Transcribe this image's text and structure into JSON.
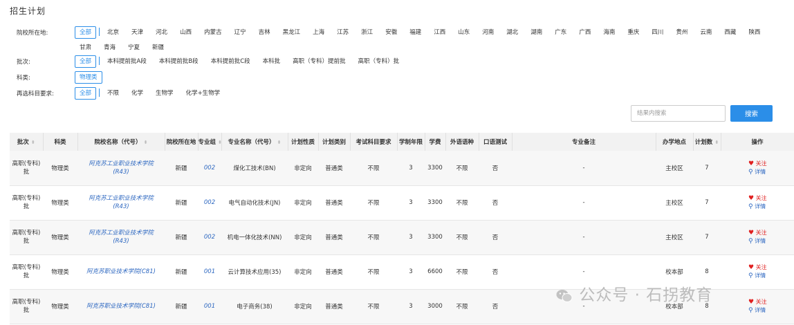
{
  "title": "招生计划",
  "filters": {
    "region": {
      "label": "院校所在地:",
      "options": [
        "全部",
        "北京",
        "天津",
        "河北",
        "山西",
        "内蒙古",
        "辽宁",
        "吉林",
        "黑龙江",
        "上海",
        "江苏",
        "浙江",
        "安徽",
        "福建",
        "江西",
        "山东",
        "河南",
        "湖北",
        "湖南",
        "广东",
        "广西",
        "海南",
        "重庆",
        "四川",
        "贵州",
        "云南",
        "西藏",
        "陕西",
        "甘肃",
        "青海",
        "宁夏",
        "新疆"
      ],
      "selected": "全部"
    },
    "batch": {
      "label": "批次:",
      "options": [
        "全部",
        "本科提前批A段",
        "本科提前批B段",
        "本科提前批C段",
        "本科批",
        "高职（专科）提前批",
        "高职（专科）批"
      ],
      "selected": "全部"
    },
    "category": {
      "label": "科类:",
      "options": [
        "物理类"
      ],
      "selected": "物理类"
    },
    "subjects": {
      "label": "再选科目要求:",
      "options": [
        "全部",
        "不限",
        "化学",
        "生物学",
        "化学+生物学"
      ],
      "selected": "全部"
    }
  },
  "search": {
    "placeholder": "结果内搜索",
    "button": "搜索"
  },
  "table": {
    "headers": [
      "批次",
      "科类",
      "院校名称（代号）",
      "院校所在地",
      "专业组",
      "专业名称（代号）",
      "计划性质",
      "计划类别",
      "考试科目要求",
      "学制年限",
      "学费",
      "外语语种",
      "口语测试",
      "专业备注",
      "办学地点",
      "计划数",
      "操作"
    ],
    "rows": [
      {
        "batch": "高职(专科)批",
        "category": "物理类",
        "school": "阿克苏工业职业技术学院(R43)",
        "location": "新疆",
        "group": "002",
        "major": "煤化工技术(BN)",
        "nature": "非定向",
        "type": "普通类",
        "requirement": "不限",
        "years": "3",
        "fee": "3300",
        "language": "不限",
        "oral": "否",
        "remark": "-",
        "campus": "主校区",
        "plan": "7"
      },
      {
        "batch": "高职(专科)批",
        "category": "物理类",
        "school": "阿克苏工业职业技术学院(R43)",
        "location": "新疆",
        "group": "002",
        "major": "电气自动化技术(JN)",
        "nature": "非定向",
        "type": "普通类",
        "requirement": "不限",
        "years": "3",
        "fee": "3300",
        "language": "不限",
        "oral": "否",
        "remark": "-",
        "campus": "主校区",
        "plan": "7"
      },
      {
        "batch": "高职(专科)批",
        "category": "物理类",
        "school": "阿克苏工业职业技术学院(R43)",
        "location": "新疆",
        "group": "002",
        "major": "机电一体化技术(NN)",
        "nature": "非定向",
        "type": "普通类",
        "requirement": "不限",
        "years": "3",
        "fee": "3300",
        "language": "不限",
        "oral": "否",
        "remark": "-",
        "campus": "主校区",
        "plan": "7"
      },
      {
        "batch": "高职(专科)批",
        "category": "物理类",
        "school": "阿克苏职业技术学院(C81)",
        "location": "新疆",
        "group": "001",
        "major": "云计算技术应用(35)",
        "nature": "非定向",
        "type": "普通类",
        "requirement": "不限",
        "years": "3",
        "fee": "6600",
        "language": "不限",
        "oral": "否",
        "remark": "-",
        "campus": "校本部",
        "plan": "8"
      },
      {
        "batch": "高职(专科)批",
        "category": "物理类",
        "school": "阿克苏职业技术学院(C81)",
        "location": "新疆",
        "group": "001",
        "major": "电子商务(38)",
        "nature": "非定向",
        "type": "普通类",
        "requirement": "不限",
        "years": "3",
        "fee": "3000",
        "language": "不限",
        "oral": "否",
        "remark": "-",
        "campus": "校本部",
        "plan": "8"
      }
    ],
    "actions": {
      "follow": "关注",
      "detail": "详情"
    }
  },
  "watermark": "公众号 · 石拐教育",
  "colors": {
    "accent": "#2b8ee8",
    "link": "#2b66c0",
    "follow": "#e02020",
    "header_bg": "#f2f2f2"
  }
}
